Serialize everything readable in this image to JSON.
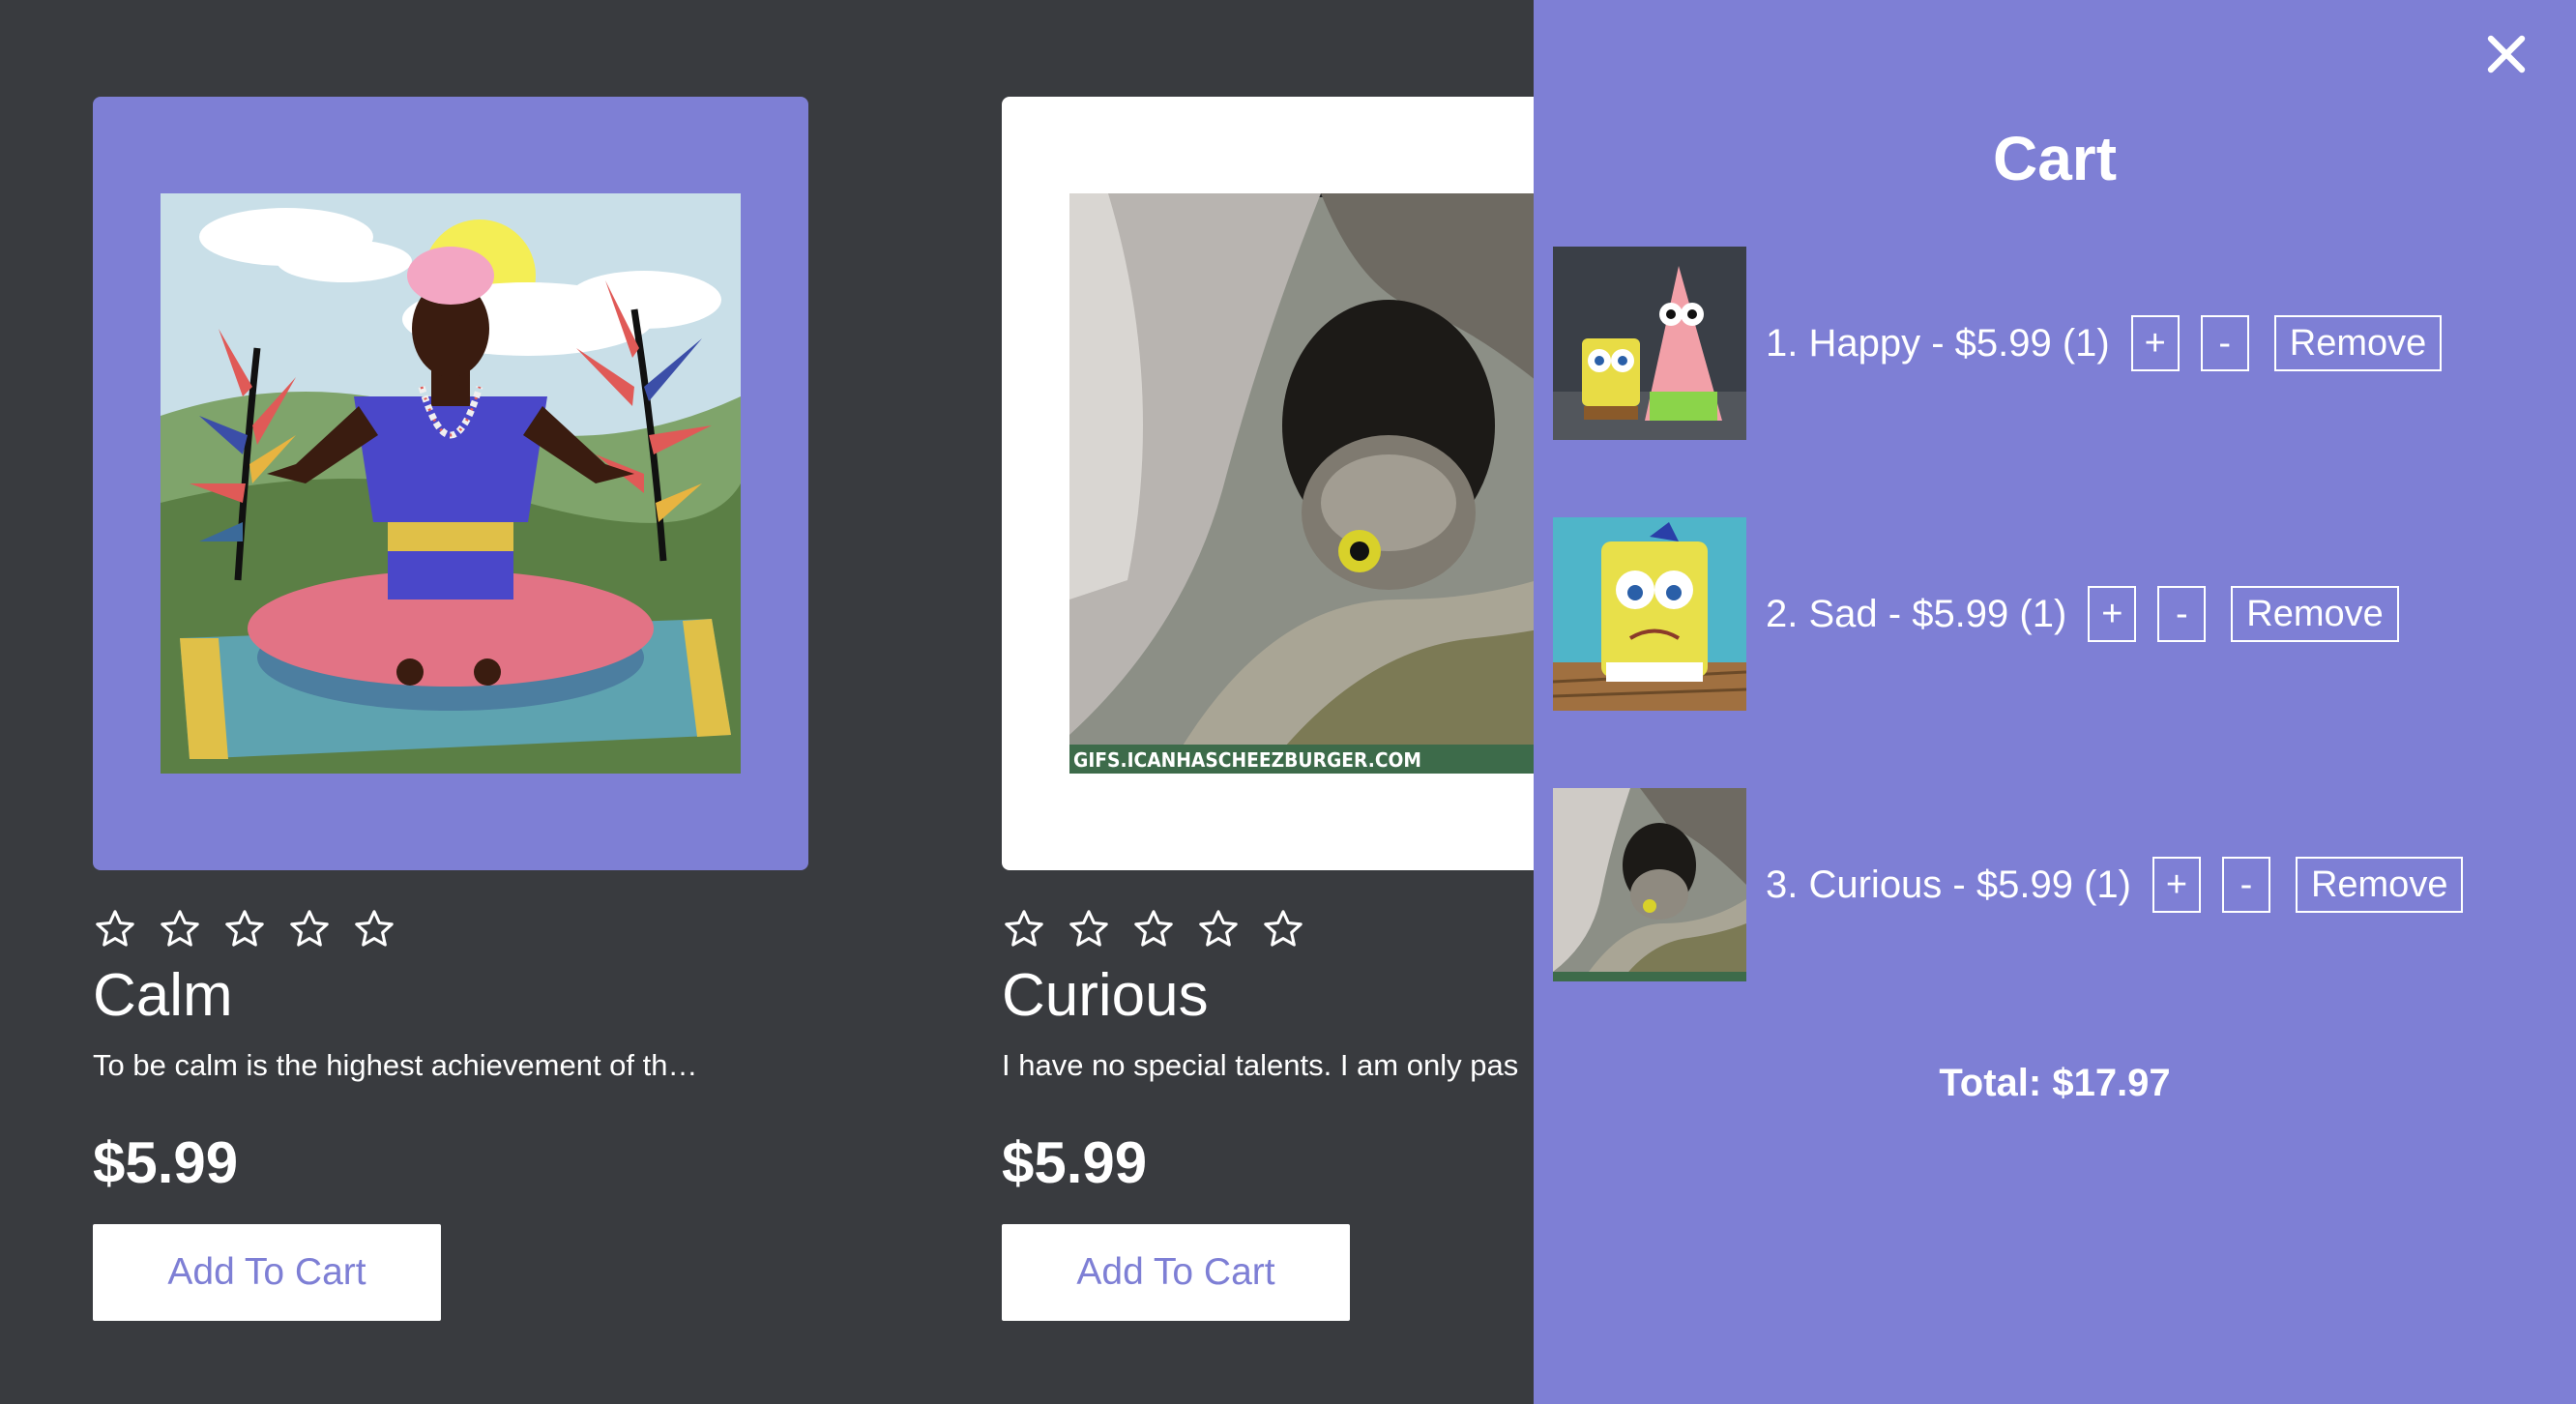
{
  "products": [
    {
      "name": "Calm",
      "description": "To be calm is the highest achievement of th…",
      "price": "$5.99",
      "button": "Add To Cart",
      "rating": 0,
      "image_watermark": ""
    },
    {
      "name": "Curious",
      "description": "I have no special talents. I am only pas",
      "price": "$5.99",
      "button": "Add To Cart",
      "rating": 0,
      "image_watermark": "GIFS.ICANHASCHEEZBURGER.COM"
    }
  ],
  "cart": {
    "title": "Cart",
    "close_icon": "close-icon",
    "items": [
      {
        "line": "1. Happy - $5.99 (1)",
        "plus": "+",
        "minus": "-",
        "remove": "Remove"
      },
      {
        "line": "2. Sad - $5.99 (1)",
        "plus": "+",
        "minus": "-",
        "remove": "Remove"
      },
      {
        "line": "3. Curious - $5.99 (1)",
        "plus": "+",
        "minus": "-",
        "remove": "Remove"
      }
    ],
    "total": "Total: $17.97"
  },
  "colors": {
    "background": "#393b3f",
    "accent": "#7e7fd5",
    "text": "#ffffff"
  }
}
